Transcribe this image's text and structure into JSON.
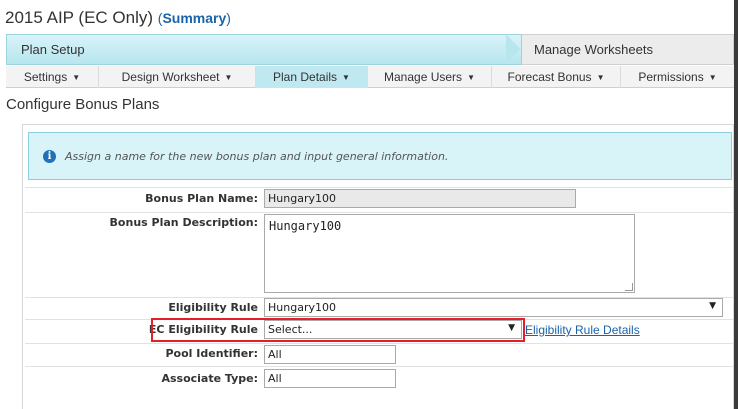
{
  "header": {
    "title": "2015 AIP (EC Only)",
    "open_paren": "(",
    "summary_link": "Summary",
    "close_paren": ")"
  },
  "progress": {
    "steps": [
      {
        "label": "Plan Setup",
        "state": "active"
      },
      {
        "label": "Manage Worksheets",
        "state": "inactive"
      }
    ]
  },
  "tabs": [
    {
      "label": "Settings",
      "active": false
    },
    {
      "label": "Design Worksheet",
      "active": false
    },
    {
      "label": "Plan Details",
      "active": true
    },
    {
      "label": "Manage Users",
      "active": false
    },
    {
      "label": "Forecast Bonus",
      "active": false
    },
    {
      "label": "Permissions",
      "active": false
    }
  ],
  "page": {
    "heading": "Configure Bonus Plans",
    "info": "Assign a name for the new bonus plan and input general information."
  },
  "form": {
    "bonus_plan_name": {
      "label": "Bonus Plan Name:",
      "value": "Hungary100"
    },
    "bonus_plan_description": {
      "label": "Bonus Plan Description:",
      "value": "Hungary100"
    },
    "eligibility_rule": {
      "label": "Eligibility Rule",
      "value": "Hungary100"
    },
    "ec_eligibility_rule": {
      "label": "EC Eligibility Rule",
      "value": "Select...",
      "link": "Eligibility Rule Details"
    },
    "pool_identifier": {
      "label": "Pool Identifier:",
      "value": "All"
    },
    "associate_type": {
      "label": "Associate Type:",
      "value": "All"
    }
  },
  "colors": {
    "accent_link": "#1a63a8",
    "active_step": "#b7e6ef",
    "info_bg": "#d9f4f8",
    "highlight": "#e3202a"
  },
  "icons": {
    "info": "info-circle-icon",
    "dropdown": "caret-down-icon"
  }
}
